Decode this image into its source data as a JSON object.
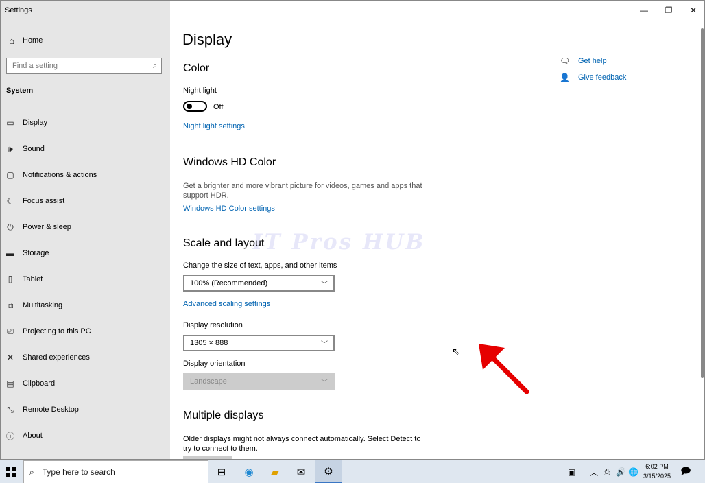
{
  "window": {
    "app_title": "Settings",
    "caption": {
      "minimize": "—",
      "restore": "❐",
      "close": "✕"
    }
  },
  "sidebar": {
    "home": {
      "icon": "home-icon",
      "label": "Home"
    },
    "search": {
      "placeholder": "Find a setting",
      "icon": "search-icon"
    },
    "section": "System",
    "items": [
      {
        "icon": "monitor-icon",
        "label": "Display"
      },
      {
        "icon": "speaker-icon",
        "label": "Sound"
      },
      {
        "icon": "notification-icon",
        "label": "Notifications & actions"
      },
      {
        "icon": "moon-icon",
        "label": "Focus assist"
      },
      {
        "icon": "power-icon",
        "label": "Power & sleep"
      },
      {
        "icon": "storage-icon",
        "label": "Storage"
      },
      {
        "icon": "tablet-icon",
        "label": "Tablet"
      },
      {
        "icon": "multitasking-icon",
        "label": "Multitasking"
      },
      {
        "icon": "projector-icon",
        "label": "Projecting to this PC"
      },
      {
        "icon": "share-icon",
        "label": "Shared experiences"
      },
      {
        "icon": "clipboard-icon",
        "label": "Clipboard"
      },
      {
        "icon": "remote-desktop-icon",
        "label": "Remote Desktop"
      },
      {
        "icon": "info-icon",
        "label": "About"
      }
    ]
  },
  "main": {
    "title": "Display",
    "color": {
      "heading": "Color",
      "night_light_label": "Night light",
      "toggle_state": "Off",
      "night_light_link": "Night light settings"
    },
    "hdr": {
      "heading": "Windows HD Color",
      "description": "Get a brighter and more vibrant picture for videos, games and apps that support HDR.",
      "link": "Windows HD Color settings"
    },
    "scale": {
      "heading": "Scale and layout",
      "size_label": "Change the size of text, apps, and other items",
      "size_value": "100% (Recommended)",
      "advanced_link": "Advanced scaling settings",
      "resolution_label": "Display resolution",
      "resolution_value": "1305 × 888",
      "orientation_label": "Display orientation",
      "orientation_value": "Landscape"
    },
    "multiple": {
      "heading": "Multiple displays",
      "description": "Older displays might not always connect automatically. Select Detect to try to connect to them."
    },
    "help": {
      "get_help": "Get help",
      "give_feedback": "Give feedback"
    },
    "watermark": "IT Pros HUB"
  },
  "colors": {
    "link": "#0063b1",
    "sidebar_bg": "#e6e6e6",
    "arrow": "#e60000",
    "taskbar_bg": "#dfe7f0"
  },
  "taskbar": {
    "search_placeholder": "Type here to search",
    "clock_time": "6:02 PM",
    "clock_date": "3/15/2025"
  }
}
